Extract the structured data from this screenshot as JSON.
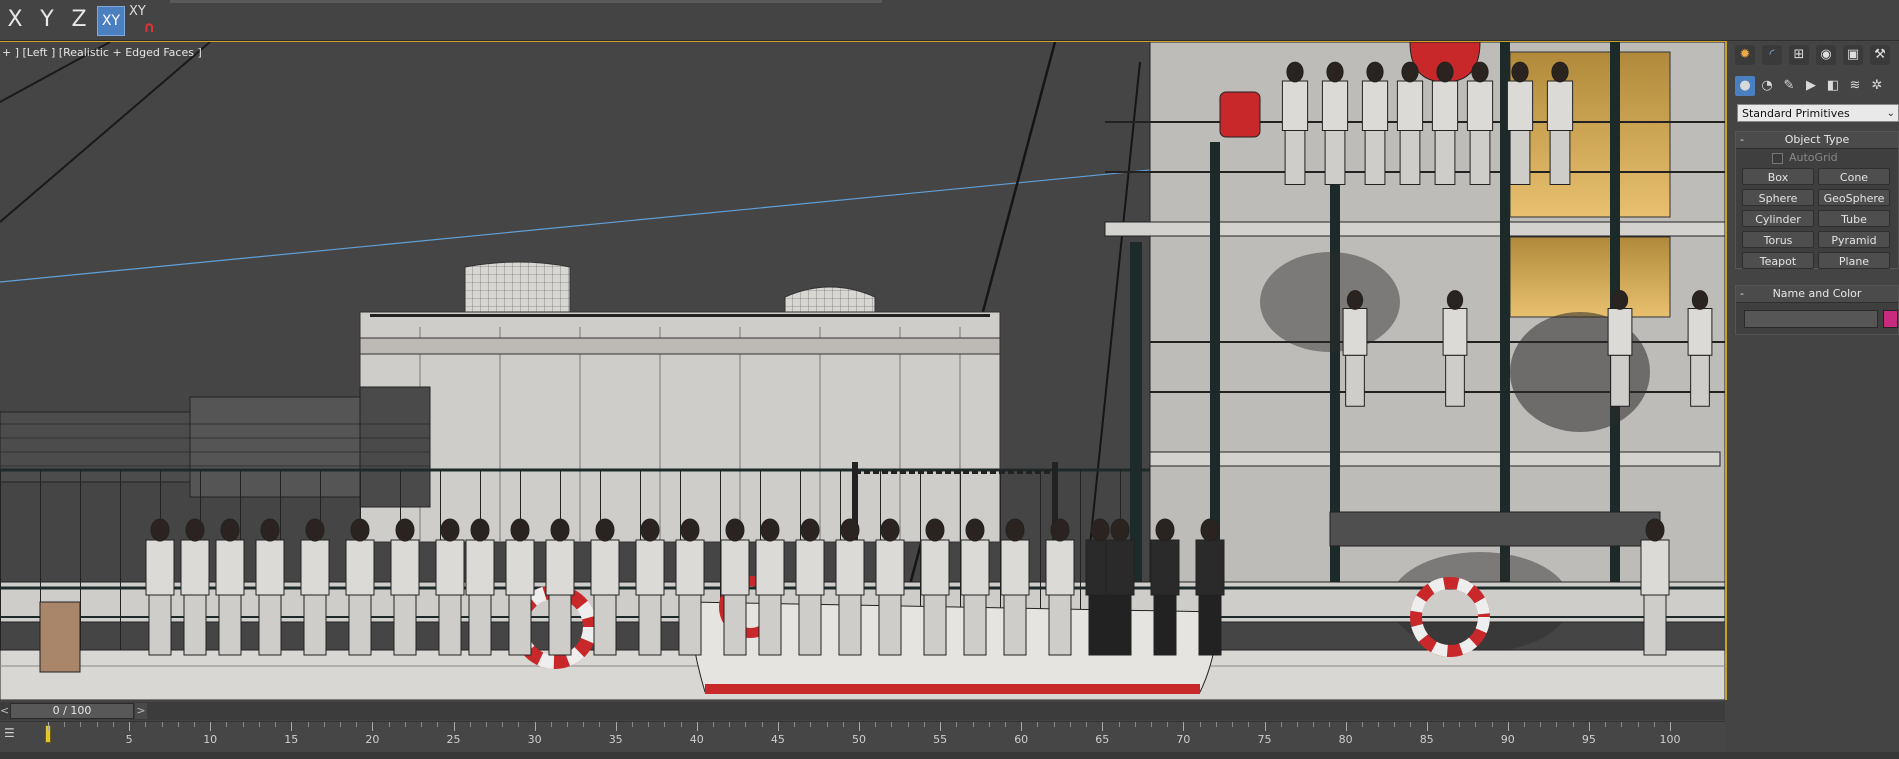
{
  "axis_constraints": {
    "x_label": "X",
    "y_label": "Y",
    "z_label": "Z",
    "xy_label": "XY",
    "xy_snap_label": "XY",
    "active": "XY"
  },
  "viewport": {
    "label": "+ ] [Left ] [Realistic + Edged Faces ]"
  },
  "command_panel": {
    "tabs": [
      "create-icon",
      "modify-icon",
      "hierarchy-icon",
      "motion-icon",
      "display-icon",
      "utilities-icon"
    ],
    "subcategories": [
      "geometry-icon",
      "shapes-icon",
      "lights-icon",
      "cameras-icon",
      "helpers-icon",
      "spacewarps-icon",
      "systems-icon"
    ],
    "category_dropdown": "Standard Primitives",
    "object_type": {
      "title": "Object Type",
      "autogrid_label": "AutoGrid",
      "buttons": [
        "Box",
        "Cone",
        "Sphere",
        "GeoSphere",
        "Cylinder",
        "Tube",
        "Torus",
        "Pyramid",
        "Teapot",
        "Plane"
      ]
    },
    "name_and_color": {
      "title": "Name and Color",
      "name_value": "",
      "color": "#c82a7d"
    }
  },
  "time_slider": {
    "value": "0 / 100",
    "prev_label": "<",
    "next_label": ">"
  },
  "track_bar": {
    "ticks": [
      "5",
      "10",
      "15",
      "20",
      "25",
      "30",
      "35",
      "40",
      "45",
      "50",
      "55",
      "60",
      "65",
      "70",
      "75",
      "80",
      "85",
      "90",
      "95",
      "100"
    ]
  },
  "colors": {
    "accent": "#4a7fc0",
    "viewport_border": "#c8a32a",
    "background": "#444444"
  }
}
